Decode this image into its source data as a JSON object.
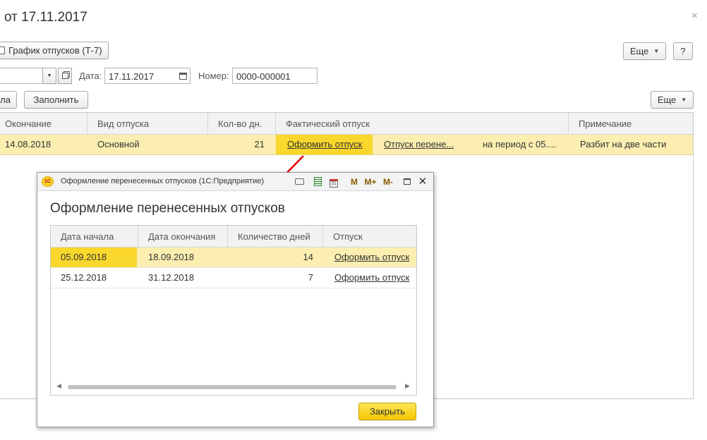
{
  "window": {
    "title": "от 17.11.2017",
    "close_glyph": "×"
  },
  "toolbar": {
    "report_button": "График отпусков (Т-7)",
    "report_icon": "document-icon",
    "more_label": "Еще",
    "help_label": "?"
  },
  "form": {
    "date_label": "Дата:",
    "date_value": "17.11.2017",
    "number_label": "Номер:",
    "number_value": "0000-000001"
  },
  "table_toolbar": {
    "left_partial_label": "ла",
    "fill_button": "Заполнить",
    "more_label": "Еще"
  },
  "main_table": {
    "columns": [
      "Окончание",
      "Вид отпуска",
      "Кол-во дн.",
      "Фактический отпуск",
      "Примечание"
    ],
    "row": {
      "end": "14.08.2018",
      "type": "Основной",
      "days": "21",
      "action_link": "Оформить отпуск",
      "moved_link": "Отпуск перене...",
      "period": "на период с 05....",
      "note": "Разбит на две части"
    }
  },
  "dialog": {
    "caption": "Оформление перенесенных отпусков  (1С:Предприятие)",
    "logo_text": "1С",
    "toolbar_icons": [
      "print-icon",
      "calculator-icon",
      "calendar-icon"
    ],
    "memory_buttons": [
      "M",
      "M+",
      "M-"
    ],
    "title": "Оформление перенесенных отпусков",
    "columns": [
      "Дата начала",
      "Дата окончания",
      "Количество дней",
      "Отпуск"
    ],
    "rows": [
      {
        "start": "05.09.2018",
        "end": "18.09.2018",
        "days": "14",
        "action": "Оформить отпуск"
      },
      {
        "start": "25.12.2018",
        "end": "31.12.2018",
        "days": "7",
        "action": "Оформить отпуск"
      }
    ],
    "close_button": "Закрыть"
  },
  "colors": {
    "row_highlight": "#fbeeb0",
    "cell_selected": "#f9d72c",
    "arrow": "#e00000",
    "primary_button": "#f5c800"
  }
}
